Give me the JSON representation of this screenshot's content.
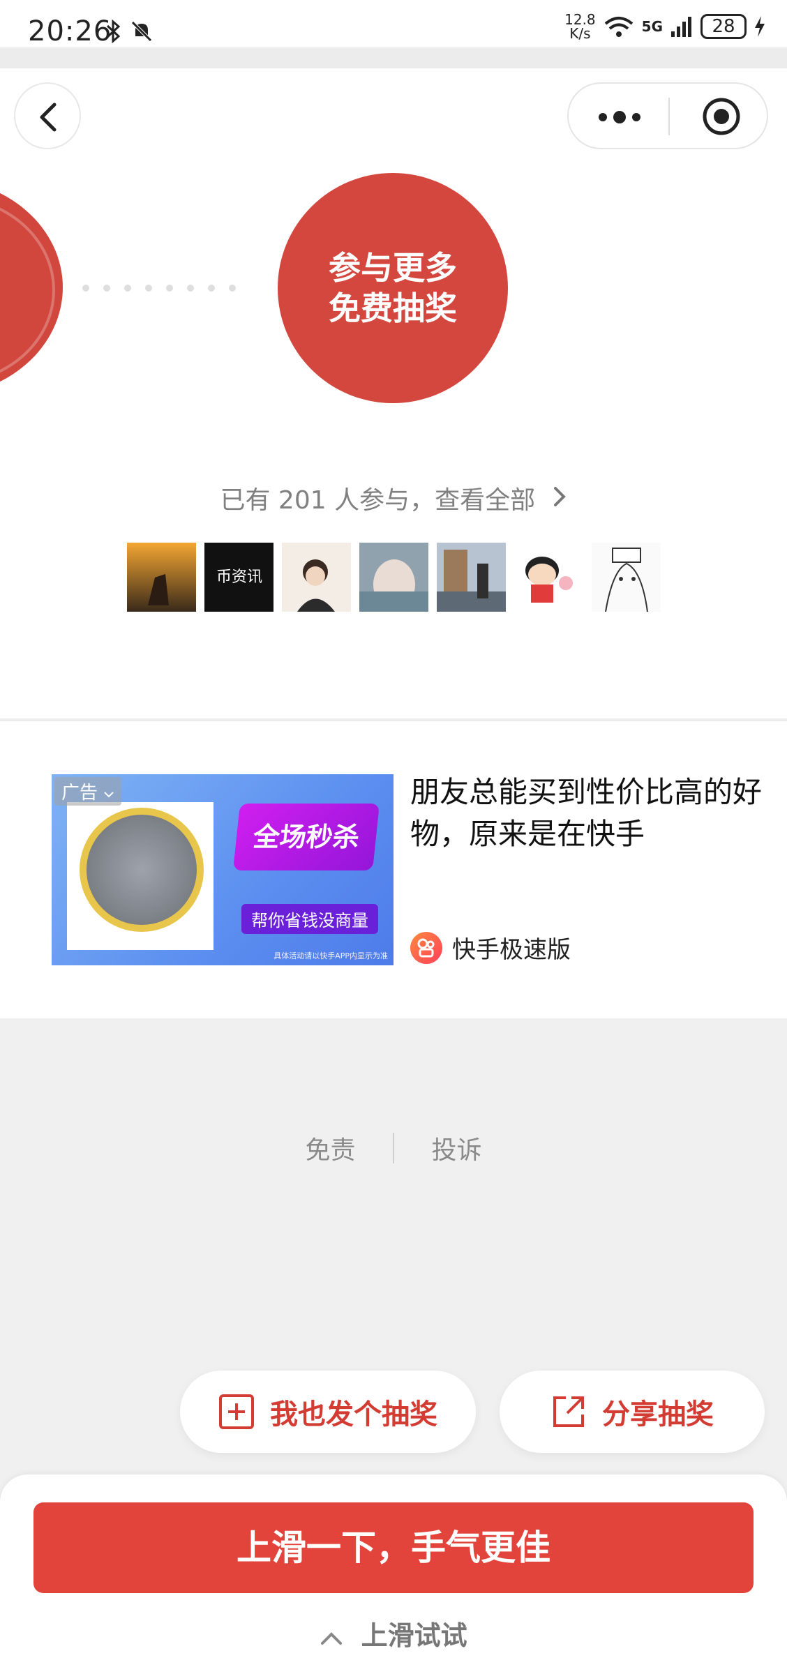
{
  "status_bar": {
    "time": "20:26",
    "speed_value": "12.8",
    "speed_unit": "K/s",
    "network": "5G",
    "battery": "28"
  },
  "nav": {
    "back_icon": "chevron-left-icon",
    "more_icon": "more-dots-icon",
    "close_icon": "target-icon"
  },
  "hero": {
    "circle_text": "参与更多免费抽奖"
  },
  "participants": {
    "text": "已有 201 人参与，查看全部",
    "avatar_labels": [
      "",
      "币资讯",
      "",
      "",
      "",
      "",
      ""
    ]
  },
  "ad": {
    "tag": "广告",
    "sale_text": "全场秒杀",
    "sub_text": "帮你省钱没商量",
    "fine_print": "具体活动请以快手APP内显示为准",
    "title": "朋友总能买到性价比高的好物，原来是在快手",
    "brand": "快手极速版"
  },
  "footer": {
    "disclaimer": "免责",
    "complain": "投诉"
  },
  "actions": {
    "create_label": "我也发个抽奖",
    "share_label": "分享抽奖"
  },
  "bottom": {
    "main_button": "上滑一下，手气更佳",
    "hint": "上滑试试"
  },
  "colors": {
    "accent_red": "#e2443b",
    "circle_red": "#d4473e"
  }
}
